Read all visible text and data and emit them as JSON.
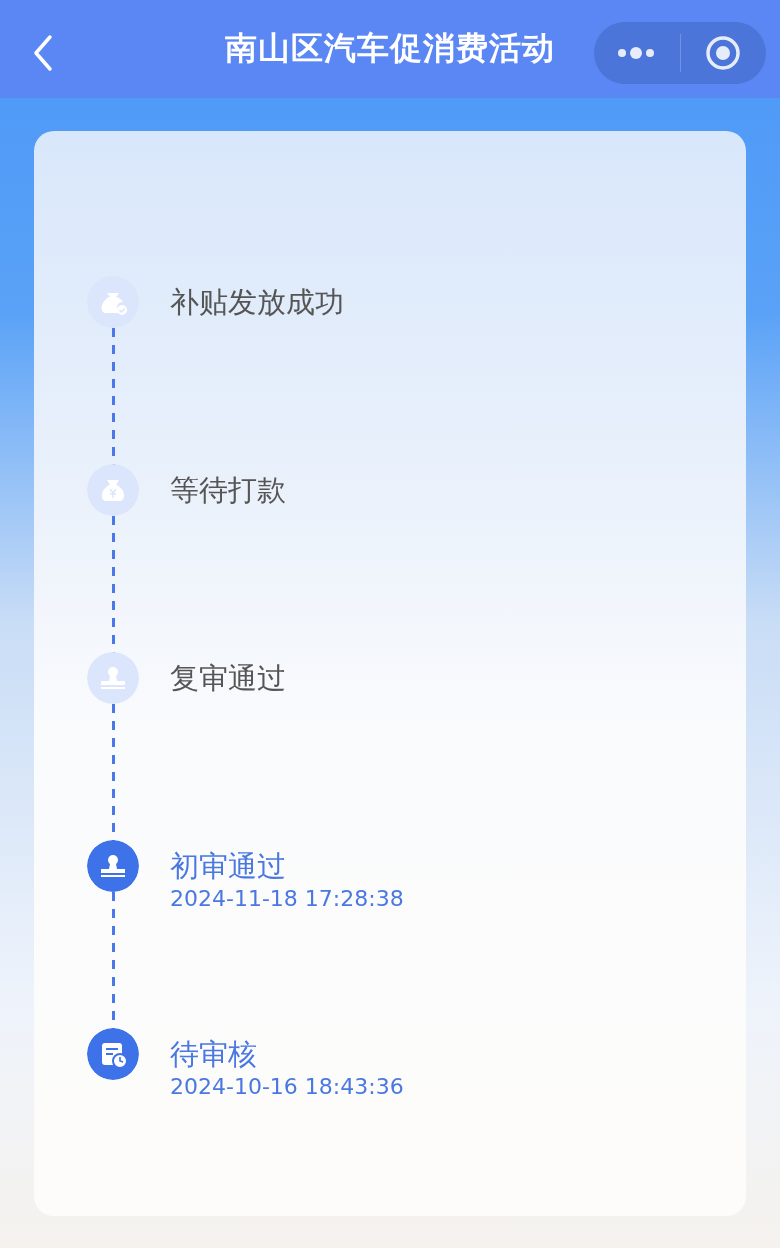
{
  "nav_bar": {
    "title": "南山区汽车促消费活动"
  },
  "steps": [
    {
      "label": "补贴发放成功",
      "done": false,
      "kind": "paid"
    },
    {
      "label": "等待打款",
      "done": false,
      "kind": "payment"
    },
    {
      "label": "复审通过",
      "done": false,
      "kind": "approval"
    },
    {
      "label": "初审通过",
      "done": true,
      "kind": "approval",
      "time": "2024-11-18 17:28:38"
    },
    {
      "label": "待审核",
      "done": true,
      "kind": "pending",
      "time": "2024-10-16 18:43:36"
    }
  ]
}
